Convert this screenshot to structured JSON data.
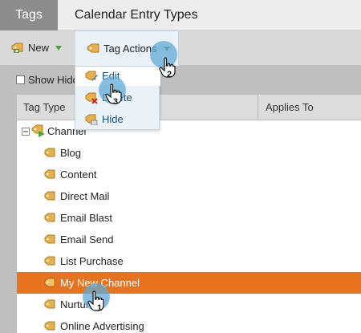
{
  "tabs": [
    {
      "label": "Tags",
      "active": true
    },
    {
      "label": "Calendar Entry Types",
      "active": false
    }
  ],
  "toolbar": {
    "new_label": "New",
    "actions_label": "Tag Actions"
  },
  "menu": {
    "items": [
      {
        "label": "Edit",
        "icon": "tag-edit-icon"
      },
      {
        "label": "Delete",
        "icon": "tag-delete-icon"
      },
      {
        "label": "Hide",
        "icon": "tag-hide-icon"
      }
    ]
  },
  "show_hidden": {
    "label": "Show Hidden"
  },
  "table": {
    "columns": [
      "Tag Type",
      "Applies To"
    ],
    "parent": {
      "label": "Channel",
      "icon": "channel-tag-icon",
      "expanded": true
    },
    "rows": [
      {
        "label": "Blog"
      },
      {
        "label": "Content"
      },
      {
        "label": "Direct Mail"
      },
      {
        "label": "Email Blast"
      },
      {
        "label": "Email Send"
      },
      {
        "label": "List Purchase"
      },
      {
        "label": "My New Channel",
        "selected": true
      },
      {
        "label": "Nurture"
      },
      {
        "label": "Online Advertising"
      }
    ]
  },
  "steps": [
    "1",
    "2",
    "3"
  ],
  "colors": {
    "selected_row": "#e8731f",
    "menu_bg": "#eaf2f8",
    "marker": "#60aad6",
    "tag_icon": "#e6b04a"
  }
}
